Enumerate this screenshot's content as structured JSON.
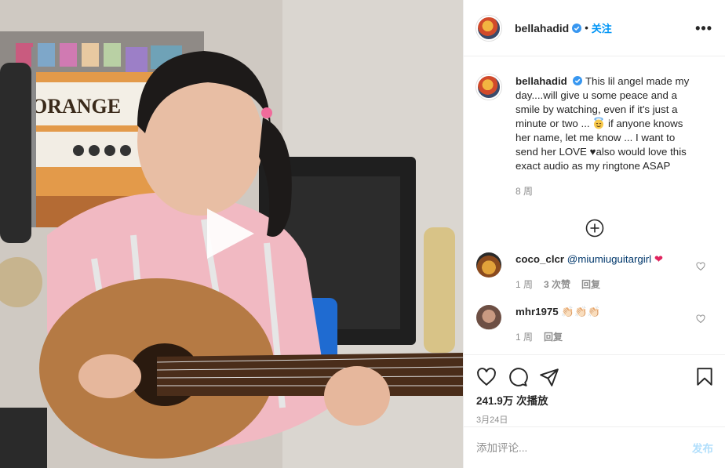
{
  "colors": {
    "accent": "#0095f6",
    "text": "#262626",
    "muted": "#8e8e8e",
    "border": "#efefef",
    "disabled_post": "#b2dffc"
  },
  "media": {
    "type": "video",
    "description_icon": "play-icon",
    "amp_brand_text": "ORANGE"
  },
  "header": {
    "username": "bellahadid",
    "verified_icon": "verified-badge-icon",
    "separator": "•",
    "follow_label": "关注",
    "more_icon": "more-options-icon",
    "more_label": "•••"
  },
  "caption": {
    "username": "bellahadid",
    "text_before_emoji": "This lil angel made my day....will give u some peace and a smile by watching, even if it's just a minute or two ... ",
    "emoji_icon": "smiling-face-with-halo-icon",
    "text_after_emoji": " if anyone knows her name, let me know ... I want to send her LOVE ♥also would love this exact audio as my ringtone ASAP",
    "time": "8 周"
  },
  "load_more_icon": "plus-circle-icon",
  "comments": [
    {
      "username": "coco_clcr",
      "mention": "@miumiuguitargirl",
      "emoji": "❤",
      "time": "1 周",
      "likes": "3 次赞",
      "reply": "回复",
      "like_icon": "heart-outline-icon"
    },
    {
      "username": "mhr1975",
      "emoji": "👏🏻👏🏻👏🏻",
      "time": "1 周",
      "reply": "回复",
      "like_icon": "heart-outline-icon"
    }
  ],
  "actions": {
    "like_icon": "heart-outline-icon",
    "comment_icon": "comment-bubble-icon",
    "share_icon": "paper-plane-icon",
    "save_icon": "bookmark-icon",
    "views": "241.9万 次播放",
    "date": "3月24日"
  },
  "add_comment": {
    "placeholder": "添加评论...",
    "post_label": "发布"
  }
}
